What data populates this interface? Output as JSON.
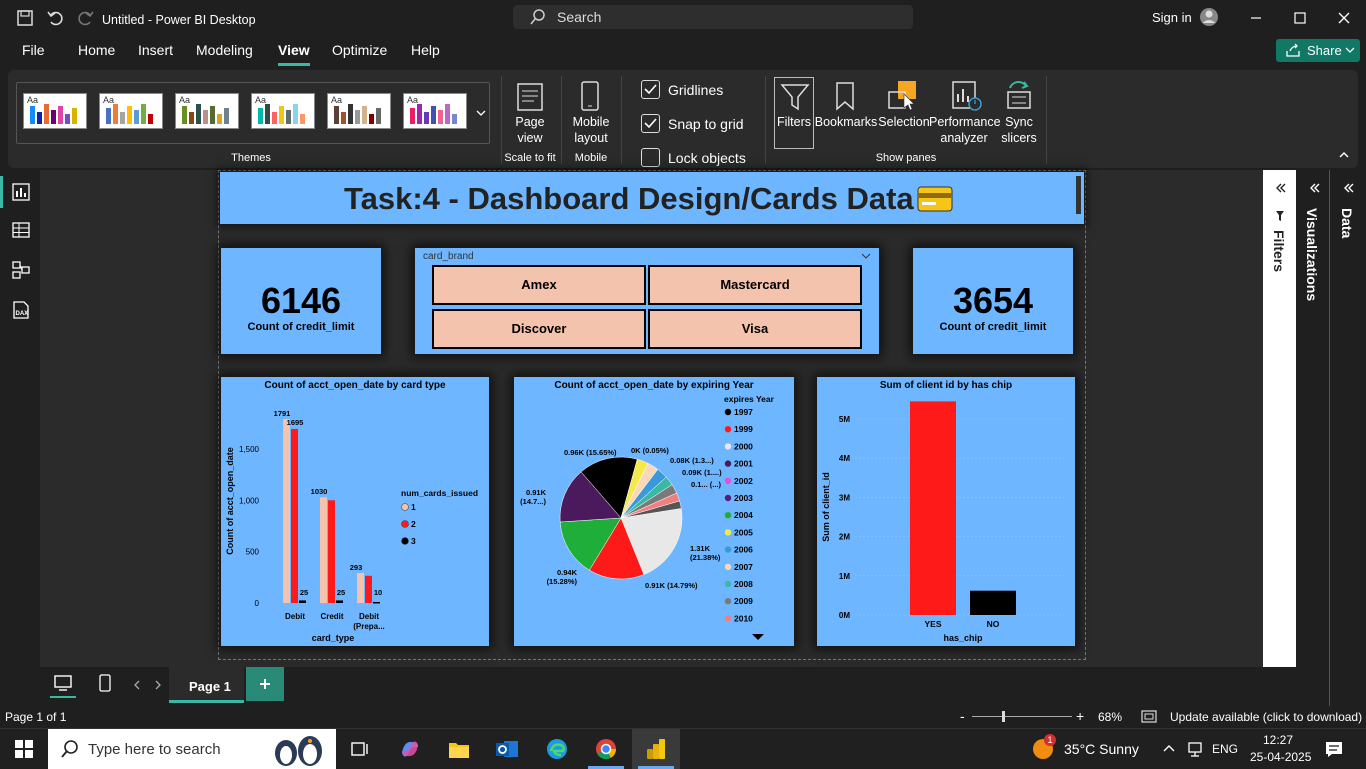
{
  "titlebar": {
    "title": "Untitled - Power BI Desktop",
    "search_placeholder": "Search",
    "sign_in": "Sign in"
  },
  "menu": [
    "File",
    "Home",
    "Insert",
    "Modeling",
    "View",
    "Optimize",
    "Help"
  ],
  "share_label": "Share",
  "ribbon": {
    "themes_label": "Themes",
    "page_view": "Page view",
    "page_view_group": "Scale to fit",
    "mobile_layout": "Mobile layout",
    "mobile_group": "Mobile",
    "gridlines": "Gridlines",
    "snap_to_grid": "Snap to grid",
    "lock_objects": "Lock objects",
    "filters": "Filters",
    "bookmarks": "Bookmarks",
    "selection": "Selection",
    "performance": "Performance analyzer",
    "sync_slicers": "Sync slicers",
    "show_panes_group": "Show panes"
  },
  "report": {
    "title": "Task:4 - Dashboard Design/Cards Data",
    "kpi_left": {
      "value": "6146",
      "label": "Count of credit_limit"
    },
    "kpi_right": {
      "value": "3654",
      "label": "Count of credit_limit"
    },
    "slicer": {
      "header": "card_brand",
      "options": [
        "Amex",
        "Mastercard",
        "Discover",
        "Visa"
      ]
    }
  },
  "chart_data": [
    {
      "type": "bar",
      "title": "Count of acct_open_date by card type",
      "xlabel": "card_type",
      "ylabel": "Count of acct_open_date",
      "categories": [
        "Debit",
        "Credit",
        "Debit (Prepa..."
      ],
      "series": [
        {
          "name": "1",
          "values": [
            1791,
            1030,
            293
          ],
          "color": "#f4c3ad"
        },
        {
          "name": "2",
          "values": [
            1695,
            1000,
            265
          ],
          "color": "#ff1a1a"
        },
        {
          "name": "3",
          "values": [
            25,
            25,
            10
          ],
          "color": "#000000"
        }
      ],
      "data_labels": [
        "1791",
        "1695",
        "25",
        "1030",
        "25",
        "293",
        "10"
      ],
      "yticks": [
        "0",
        "500",
        "1,000",
        "1,500"
      ],
      "ylim": [
        0,
        1850
      ],
      "legend_title": "num_cards_issued"
    },
    {
      "type": "pie",
      "title": "Count of acct_open_date by expiring Year",
      "legend_title": "expires Year",
      "legend": [
        {
          "label": "1997",
          "color": "#000000"
        },
        {
          "label": "1999",
          "color": "#ff1a1a"
        },
        {
          "label": "2000",
          "color": "#e8e8e8"
        },
        {
          "label": "2001",
          "color": "#4a1a5c"
        },
        {
          "label": "2002",
          "color": "#e94fd6"
        },
        {
          "label": "2003",
          "color": "#5c1a7a"
        },
        {
          "label": "2004",
          "color": "#1fae3a"
        },
        {
          "label": "2005",
          "color": "#f5e94a"
        },
        {
          "label": "2006",
          "color": "#3a9ad9"
        },
        {
          "label": "2007",
          "color": "#f8d8b8"
        },
        {
          "label": "2008",
          "color": "#3bb8a3"
        },
        {
          "label": "2009",
          "color": "#7a7a7a"
        },
        {
          "label": "2010",
          "color": "#f08080"
        }
      ],
      "slices": [
        {
          "label": "1.31K (21.38%)",
          "value": 21.38,
          "color": "#e8e8e8"
        },
        {
          "label": "0.91K (14.79%)",
          "value": 14.79,
          "color": "#ff1a1a"
        },
        {
          "label": "0.94K (15.28%)",
          "value": 15.28,
          "color": "#1fae3a"
        },
        {
          "label": "0.91K (14.7...)",
          "value": 14.7,
          "color": "#4a1a5c"
        },
        {
          "label": "0.96K (15.65%)",
          "value": 15.65,
          "color": "#000000"
        },
        {
          "label": "0K (0.05%)",
          "value": 3.0,
          "color": "#f5e94a"
        },
        {
          "label": "",
          "value": 3.0,
          "color": "#f8d8b8"
        },
        {
          "label": "",
          "value": 3.0,
          "color": "#3a9ad9"
        },
        {
          "label": "0.08K (1.3...)",
          "value": 2.5,
          "color": "#3bb8a3"
        },
        {
          "label": "0.09K (1....)",
          "value": 2.5,
          "color": "#7a7a7a"
        },
        {
          "label": "",
          "value": 2.2,
          "color": "#f08080"
        },
        {
          "label": "0.1... (...)",
          "value": 2.0,
          "color": "#555555"
        }
      ]
    },
    {
      "type": "bar",
      "title": "Sum of client id by has chip",
      "xlabel": "has_chip",
      "ylabel": "Sum of client_id",
      "categories": [
        "YES",
        "NO"
      ],
      "values": [
        5450000,
        620000
      ],
      "colors": [
        "#ff1a1a",
        "#000000"
      ],
      "yticks": [
        "0M",
        "1M",
        "2M",
        "3M",
        "4M",
        "5M"
      ],
      "ylim": [
        0,
        5000000
      ]
    }
  ],
  "panes": {
    "filters": "Filters",
    "visualizations": "Visualizations",
    "data": "Data"
  },
  "pagebar": {
    "page_tab": "Page 1"
  },
  "status": {
    "page": "Page 1 of 1",
    "zoom": "68%",
    "update": "Update available (click to download)"
  },
  "taskbar": {
    "search_placeholder": "Type here to search",
    "weather": "35°C  Sunny",
    "lang": "ENG",
    "time": "12:27",
    "date": "25-04-2025",
    "notif_badge": "1"
  }
}
